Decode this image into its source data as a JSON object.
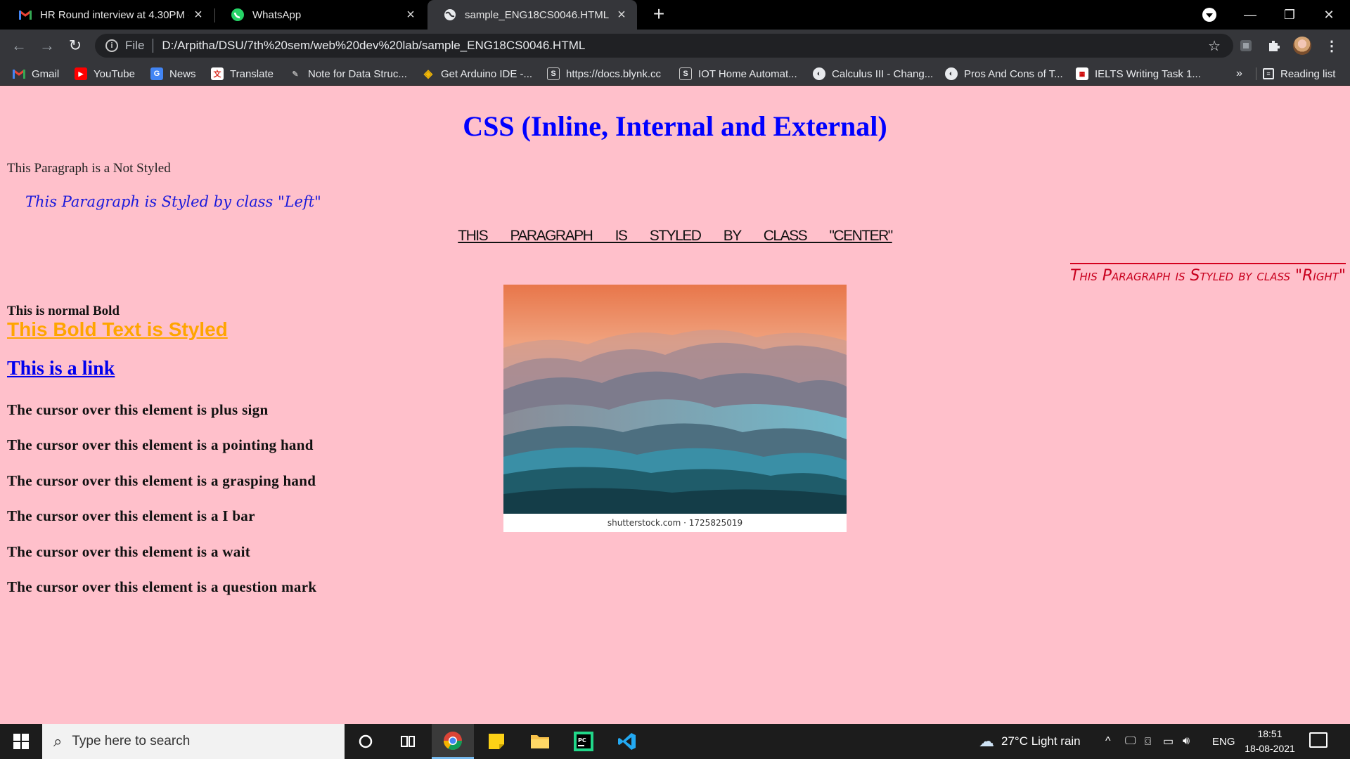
{
  "browser": {
    "tabs": [
      {
        "title": "HR Round interview at 4.30PM - ",
        "icon": "gmail-icon",
        "active": false
      },
      {
        "title": "WhatsApp",
        "icon": "whatsapp-icon",
        "active": false
      },
      {
        "title": "sample_ENG18CS0046.HTML",
        "icon": "globe-icon",
        "active": true
      }
    ],
    "address": {
      "scheme": "File",
      "url": "D:/Arpitha/DSU/7th%20sem/web%20dev%20lab/sample_ENG18CS0046.HTML"
    },
    "bookmarks": [
      {
        "label": "Gmail",
        "icon": "gmail-icon"
      },
      {
        "label": "YouTube",
        "icon": "youtube-icon"
      },
      {
        "label": "News",
        "icon": "google-news-icon"
      },
      {
        "label": "Translate",
        "icon": "translate-icon"
      },
      {
        "label": "Note for Data Struc...",
        "icon": "note-icon"
      },
      {
        "label": "Get Arduino IDE -...",
        "icon": "arduino-icon"
      },
      {
        "label": "https://docs.blynk.cc",
        "icon": "s-site-icon"
      },
      {
        "label": "IOT Home Automat...",
        "icon": "s-site-icon"
      },
      {
        "label": "Calculus III - Chang...",
        "icon": "globe-icon"
      },
      {
        "label": "Pros And Cons of T...",
        "icon": "globe-icon"
      },
      {
        "label": "IELTS Writing Task 1...",
        "icon": "ielts-icon"
      }
    ],
    "bookmarks_overflow": "»",
    "reading_list": "Reading list"
  },
  "page": {
    "title": "CSS (Inline, Internal and External)",
    "p_plain": "This Paragraph is a Not Styled",
    "p_left": "This Paragraph is Styled by class \"Left\"",
    "p_center": "THIS PARAGRAPH IS STYLED BY CLASS \"CENTER\"",
    "p_right": "This Paragraph is Styled by class \"Right\"",
    "bold_normal": "This is normal Bold",
    "bold_styled": "This Bold Text is Styled",
    "link": "This is a link",
    "cursor_items": [
      "The cursor over this element is plus sign",
      "The cursor over this element is a pointing hand",
      "The cursor over this element is a grasping hand",
      "The cursor over this element is a I bar",
      "The cursor over this element is a wait",
      "The cursor over this element is a question mark"
    ],
    "image_caption": "shutterstock.com · 1725825019"
  },
  "taskbar": {
    "search_placeholder": "Type here to search",
    "weather": "27°C  Light rain",
    "language": "ENG",
    "time": "18:51",
    "date": "18-08-2021"
  },
  "colors": {
    "page_bg": "#ffc0cb",
    "title": "#0000ff",
    "bold_styled": "#ffa500",
    "right_para": "#c8001e"
  }
}
